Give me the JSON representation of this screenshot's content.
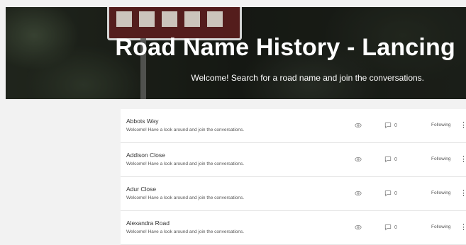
{
  "hero": {
    "title": "Road Name History - Lancing",
    "subtitle": "Welcome! Search for a road name and join the conversations."
  },
  "posts": [
    {
      "title": "Abbots Way",
      "description": "Welcome! Have a look around and join the conversations.",
      "comments": "0",
      "follow_label": "Following"
    },
    {
      "title": "Addison Close",
      "description": "Welcome! Have a look around and join the conversations.",
      "comments": "0",
      "follow_label": "Following"
    },
    {
      "title": "Adur Close",
      "description": "Welcome! Have a look around and join the conversations.",
      "comments": "0",
      "follow_label": "Following"
    },
    {
      "title": "Alexandra Road",
      "description": "Welcome! Have a look around and join the conversations.",
      "comments": "0",
      "follow_label": "Following"
    }
  ],
  "icons": {
    "views": "eye-icon",
    "comments": "comment-icon",
    "more": "more-vertical-icon"
  },
  "colors": {
    "hero_sign": "#5b1e1e",
    "background": "#f2f2f2",
    "card": "#ffffff"
  }
}
